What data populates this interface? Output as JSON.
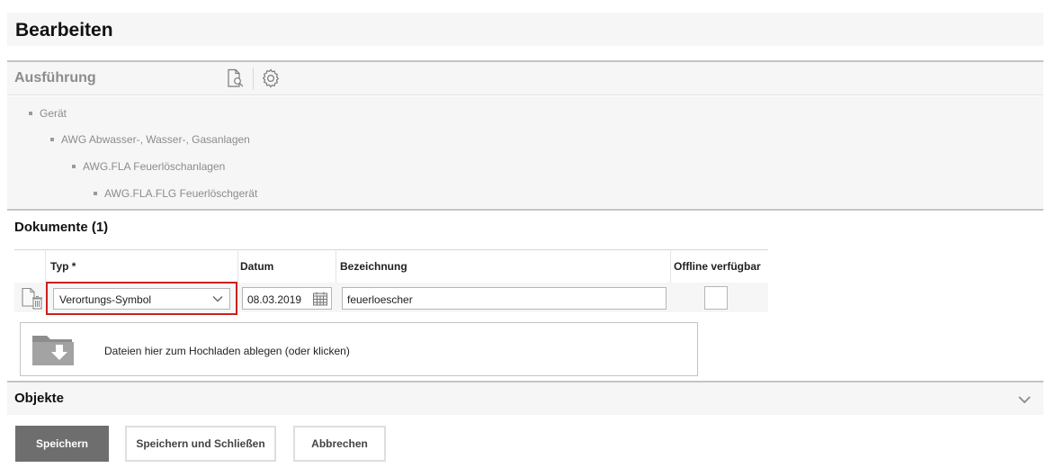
{
  "page_title": "Bearbeiten",
  "execution": {
    "label": "Ausführung",
    "icons": [
      "document-search-icon",
      "gear-icon"
    ]
  },
  "tree": [
    {
      "label": "Gerät",
      "level": 0
    },
    {
      "label": "AWG Abwasser-, Wasser-, Gasanlagen",
      "level": 1
    },
    {
      "label": "AWG.FLA Feuerlöschanlagen",
      "level": 2
    },
    {
      "label": "AWG.FLA.FLG Feuerlöschgerät",
      "level": 3
    }
  ],
  "documents": {
    "title": "Dokumente (1)",
    "columns": {
      "type": "Typ *",
      "date": "Datum",
      "name": "Bezeichnung",
      "offline": "Offline verfügbar"
    },
    "row": {
      "icon": "delete-document-icon",
      "type_value": "Verortungs-Symbol",
      "date_value": "08.03.2019",
      "name_value": "feuerloescher",
      "offline_checked": false
    },
    "dropzone_text": "Dateien hier zum Hochladen ablegen (oder klicken)",
    "dropzone_icon": "folder-download-icon"
  },
  "objects": {
    "label": "Objekte",
    "expanded": false,
    "icon": "chevron-down-icon"
  },
  "buttons": {
    "save": "Speichern",
    "save_close": "Speichern und Schließen",
    "cancel": "Abbrechen"
  },
  "colors": {
    "highlight": "#cc1f1f",
    "primary_button": "#6e6e6e",
    "section_bg": "#f6f6f6"
  }
}
